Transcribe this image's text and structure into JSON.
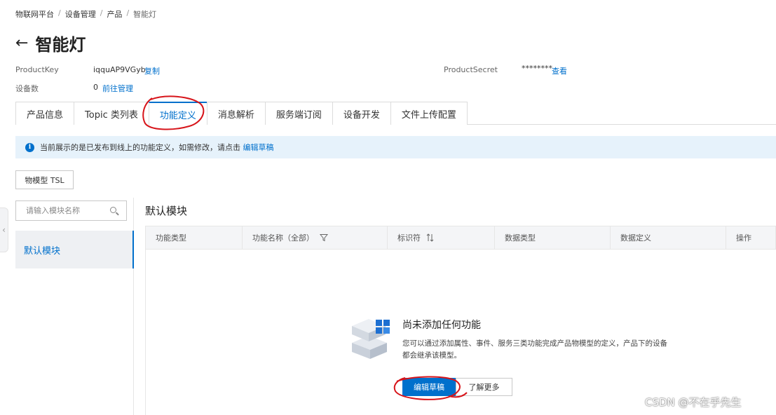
{
  "breadcrumb": {
    "items": [
      "物联网平台",
      "设备管理",
      "产品"
    ],
    "current": "智能灯",
    "separator": "/"
  },
  "header": {
    "back_icon": "←",
    "title": "智能灯"
  },
  "info": {
    "product_key_label": "ProductKey",
    "product_key_value": "iqquAP9VGyb",
    "product_key_copy": "复制",
    "product_secret_label": "ProductSecret",
    "product_secret_value": "********",
    "product_secret_view": "查看",
    "device_count_label": "设备数",
    "device_count_value": "0",
    "device_count_link": "前往管理"
  },
  "tabs": [
    {
      "label": "产品信息"
    },
    {
      "label": "Topic 类列表"
    },
    {
      "label": "功能定义",
      "active": true
    },
    {
      "label": "消息解析"
    },
    {
      "label": "服务端订阅"
    },
    {
      "label": "设备开发"
    },
    {
      "label": "文件上传配置"
    }
  ],
  "notice": {
    "icon": "i",
    "text": "当前展示的是已发布到线上的功能定义，如需修改，请点击",
    "link": "编辑草稿"
  },
  "tsl_button": "物模型 TSL",
  "side_handle_icon": "‹",
  "search": {
    "placeholder": "请输入模块名称"
  },
  "modules": [
    {
      "label": "默认模块",
      "active": true
    }
  ],
  "module_title": "默认模块",
  "table": {
    "columns": [
      {
        "label": "功能类型",
        "icon": ""
      },
      {
        "label": "功能名称（全部）",
        "icon": "filter-icon"
      },
      {
        "label": "标识符",
        "icon": "sort-icon"
      },
      {
        "label": "数据类型",
        "icon": ""
      },
      {
        "label": "数据定义",
        "icon": ""
      },
      {
        "label": "操作",
        "icon": ""
      }
    ]
  },
  "empty": {
    "title": "尚未添加任何功能",
    "desc": "您可以通过添加属性、事件、服务三类功能完成产品物模型的定义，产品下的设备都会继承该模型。",
    "primary_button": "编辑草稿",
    "secondary_button": "了解更多"
  },
  "watermark": "CSDN @不在乎先生",
  "colors": {
    "accent": "#0070cc",
    "notice_bg": "#e6f2fb",
    "annotation": "#d7141a"
  }
}
